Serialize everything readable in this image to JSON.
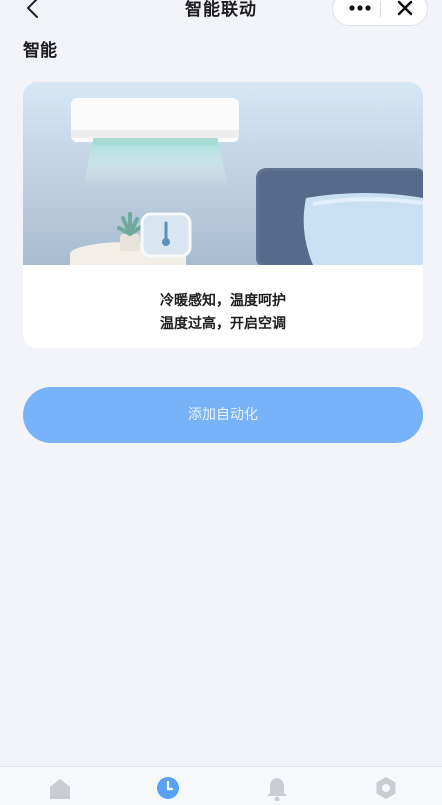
{
  "header": {
    "title": "智能联动",
    "back_icon": "chevron-left-icon",
    "more_icon": "more-dots-icon",
    "close_icon": "close-icon"
  },
  "section": {
    "title": "智能"
  },
  "card": {
    "illustration": "bedroom-air-conditioner-illustration",
    "line1": "冷暖感知，温度呵护",
    "line2": "温度过高，开启空调"
  },
  "actions": {
    "add_label": "添加自动化"
  },
  "tabbar": {
    "items": [
      {
        "icon": "home-icon",
        "active": false
      },
      {
        "icon": "clock-icon",
        "active": true
      },
      {
        "icon": "bell-icon",
        "active": false
      },
      {
        "icon": "settings-icon",
        "active": false
      }
    ]
  },
  "colors": {
    "accent": "#78b3fa",
    "background": "#f2f4f9",
    "tab_active": "#5aa2f7",
    "tab_inactive": "#c9ccd2"
  }
}
